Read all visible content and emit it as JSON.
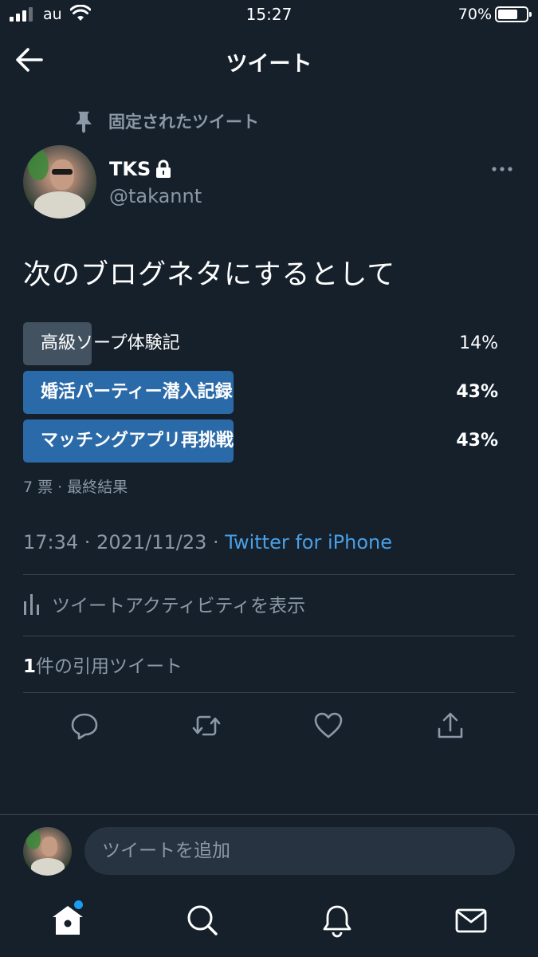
{
  "status_bar": {
    "carrier": "au",
    "time": "15:27",
    "battery_percent": "70%",
    "battery_level": 0.7,
    "signal_bars": 3,
    "signal_bars_total": 4
  },
  "header": {
    "title": "ツイート",
    "back_icon": "arrow-left-icon"
  },
  "tweet": {
    "pinned_label": "固定されたツイート",
    "author": {
      "name": "TKS",
      "handle": "@takannt",
      "protected": true
    },
    "text": "次のブログネタにするとして",
    "poll": {
      "options": [
        {
          "label": "高級ソープ体験記",
          "percent": "14%",
          "value": 14,
          "winner": false
        },
        {
          "label": "婚活パーティー潜入記録",
          "percent": "43%",
          "value": 43,
          "winner": true
        },
        {
          "label": "マッチングアプリ再挑戦",
          "percent": "43%",
          "value": 43,
          "winner": true
        }
      ],
      "meta": "7 票 · 最終結果"
    },
    "timestamp": "17:34 · 2021/11/23 · ",
    "source": "Twitter for iPhone",
    "activity_label": "ツイートアクティビティを表示",
    "quote_count": "1",
    "quote_label": "件の引用ツイート"
  },
  "reply": {
    "placeholder": "ツイートを追加"
  },
  "tab_bar": {
    "items": [
      "home-icon",
      "search-icon",
      "bell-icon",
      "mail-icon"
    ]
  },
  "colors": {
    "background": "#15202b",
    "accent": "#1d9bf0",
    "poll_winner": "#2b6aa8",
    "poll_loser": "#435260",
    "secondary_text": "#8b98a5"
  }
}
